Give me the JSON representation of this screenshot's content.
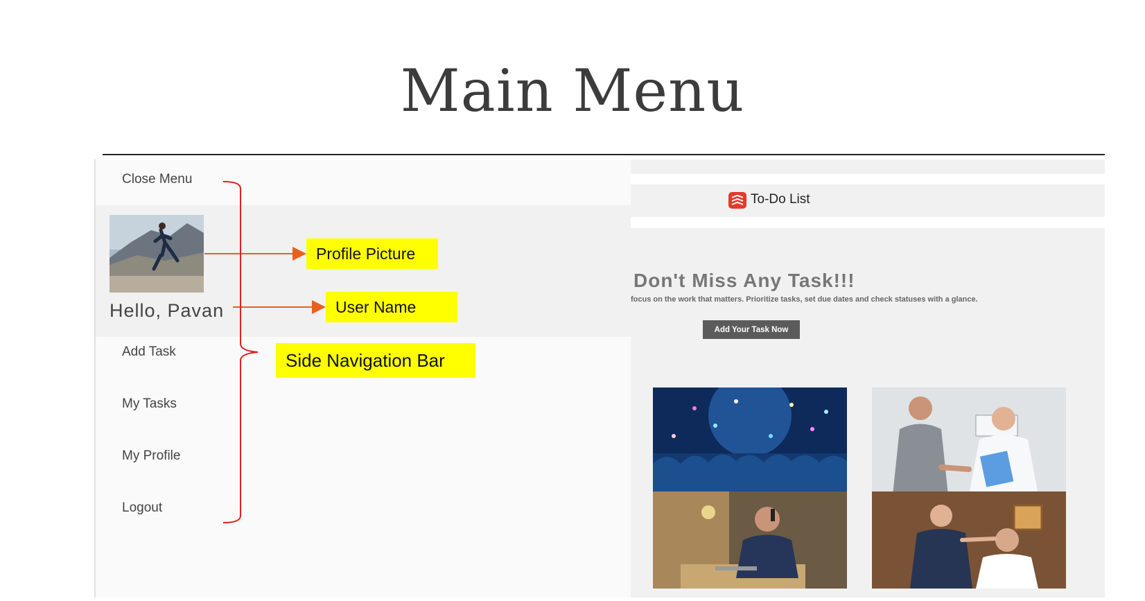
{
  "slide": {
    "title": "Main Menu"
  },
  "sidenav": {
    "close_label": "Close Menu",
    "greeting": "Hello, Pavan",
    "items": [
      {
        "label": "Add Task"
      },
      {
        "label": "My Tasks"
      },
      {
        "label": "My Profile"
      },
      {
        "label": "Logout"
      }
    ]
  },
  "annotations": {
    "profile_picture": "Profile Picture",
    "user_name": "User Name",
    "side_nav": "Side Navigation Bar",
    "highlight_color": "#ffff00",
    "arrow_color": "#e8601c",
    "bracket_color": "#e02020"
  },
  "app": {
    "name": "To-Do List",
    "hero_title": "Don't Miss Any Task!!!",
    "hero_subtitle": "focus on the work that matters. Prioritize tasks, set due dates and check statuses with a glance.",
    "cta_label": "Add Your Task Now",
    "photos": [
      {
        "icon": "concert-crowd-photo"
      },
      {
        "icon": "doctor-handshake-photo"
      },
      {
        "icon": "man-on-phone-photo"
      },
      {
        "icon": "barber-shop-photo"
      }
    ]
  }
}
